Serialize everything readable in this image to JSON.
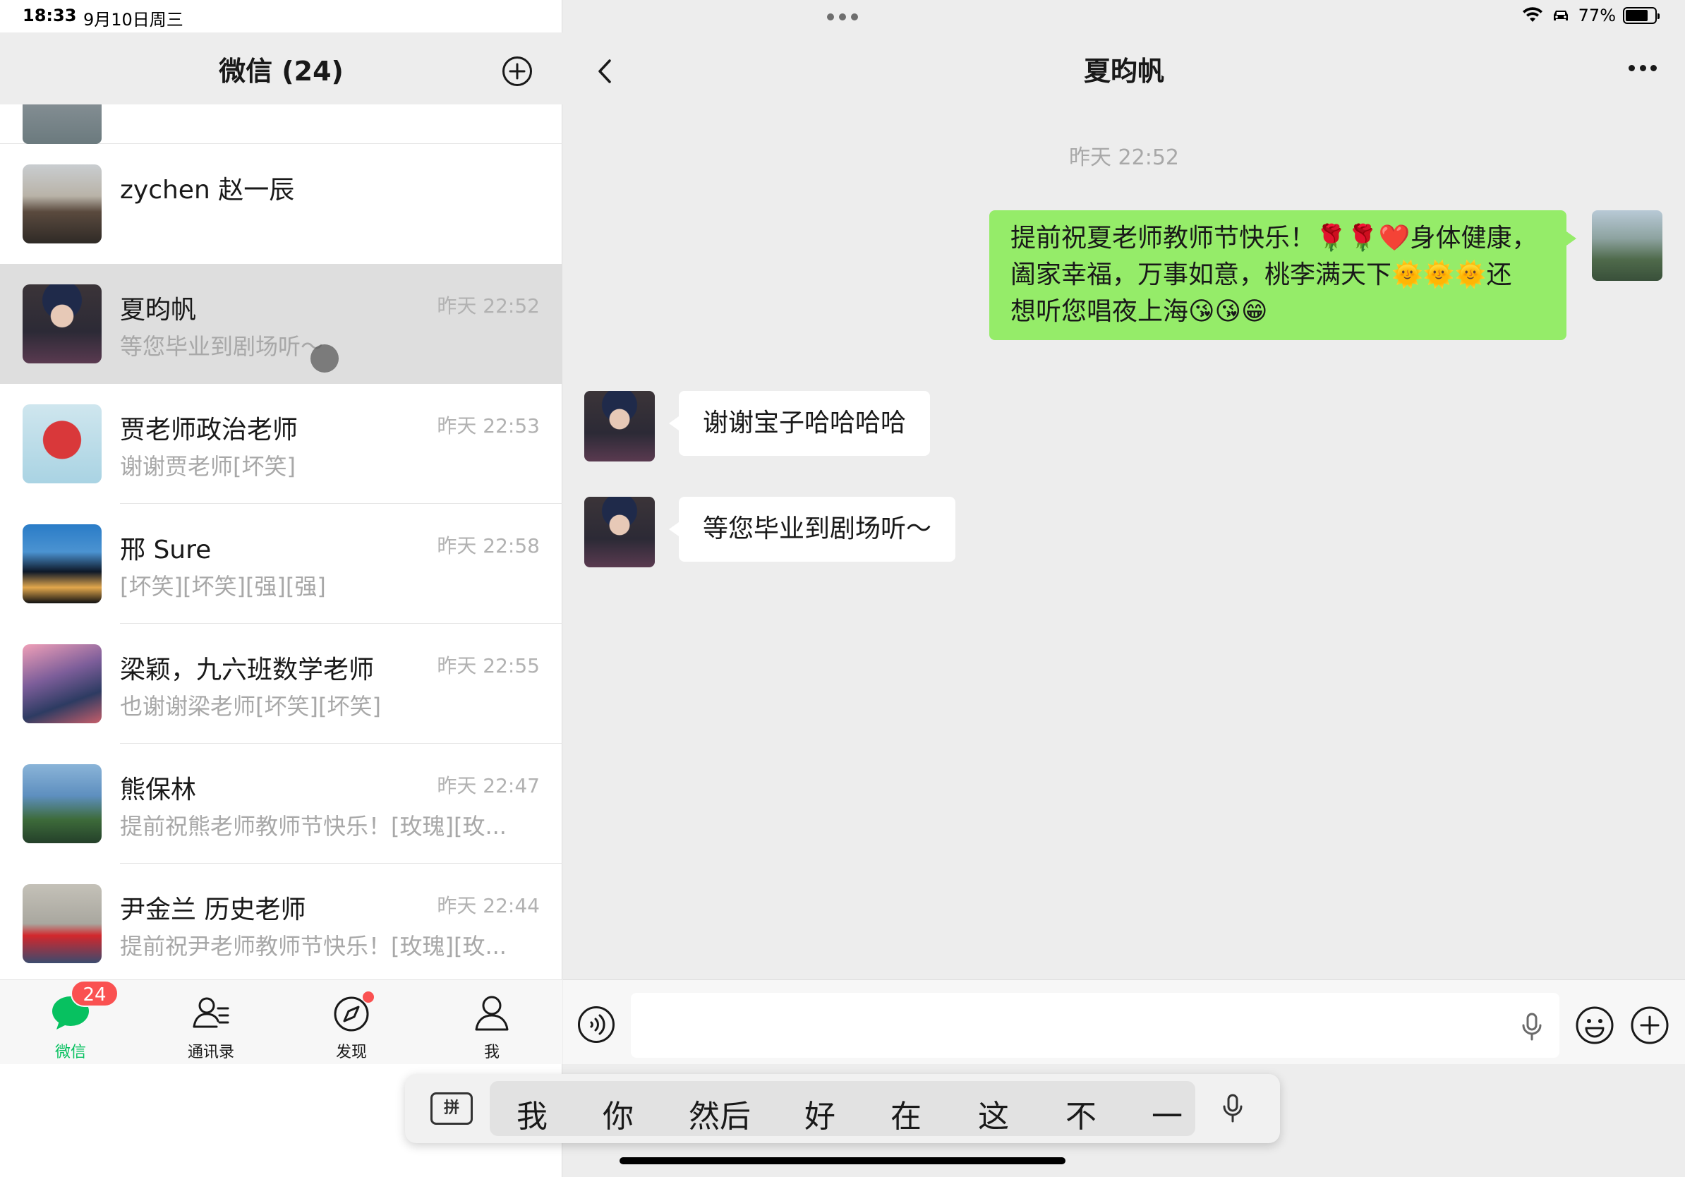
{
  "status": {
    "time": "18:33",
    "date": "9月10日周三",
    "battery_pct": "77%",
    "battery_level": 0.77
  },
  "left": {
    "title": "微信 (24)",
    "chats": [
      {
        "name": "zychen 赵一辰",
        "time": "",
        "preview": ""
      },
      {
        "name": "夏昀帆",
        "time": "昨天 22:52",
        "preview": "等您毕业到剧场听～"
      },
      {
        "name": "贾老师政治老师",
        "time": "昨天 22:53",
        "preview": "谢谢贾老师[坏笑]"
      },
      {
        "name": "邢 Sure",
        "time": "昨天 22:58",
        "preview": "[坏笑][坏笑][强][强]"
      },
      {
        "name": "梁颖，九六班数学老师",
        "time": "昨天 22:55",
        "preview": "也谢谢梁老师[坏笑][坏笑]"
      },
      {
        "name": "熊保林",
        "time": "昨天 22:47",
        "preview": "提前祝熊老师教师节快乐！[玫瑰][玫..."
      },
      {
        "name": "尹金兰 历史老师",
        "time": "昨天 22:44",
        "preview": "提前祝尹老师教师节快乐！[玫瑰][玫..."
      }
    ],
    "tabs": [
      {
        "label": "微信",
        "badge": "24"
      },
      {
        "label": "通讯录"
      },
      {
        "label": "发现"
      },
      {
        "label": "我"
      }
    ]
  },
  "chat": {
    "title": "夏昀帆",
    "timestamp": "昨天 22:52",
    "messages": [
      {
        "from": "me",
        "text_lines": [
          "提前祝夏老师教师节快乐！🌹🌹❤️身体健康，",
          "阖家幸福，万事如意，桃李满天下🌞🌞🌞还",
          "想听您唱夜上海😘😘😁"
        ]
      },
      {
        "from": "other",
        "text": "谢谢宝子哈哈哈哈"
      },
      {
        "from": "other",
        "text": "等您毕业到剧场听～"
      }
    ],
    "input": {
      "value": "",
      "placeholder": ""
    }
  },
  "keyboard": {
    "mode": "拼",
    "candidates": [
      "我",
      "你",
      "然后",
      "好",
      "在",
      "这",
      "不",
      "一"
    ]
  },
  "colors": {
    "accent_green": "#07c160",
    "sent_bubble": "#95ec69",
    "badge_red": "#fa5151"
  },
  "icons": [
    "plus-circle-icon",
    "back-chevron-icon",
    "more-dots-icon",
    "chat-bubble-icon",
    "contacts-icon",
    "compass-icon",
    "person-icon",
    "voice-icon",
    "mic-icon",
    "emoji-icon",
    "wifi-icon",
    "car-icon",
    "battery-icon"
  ]
}
